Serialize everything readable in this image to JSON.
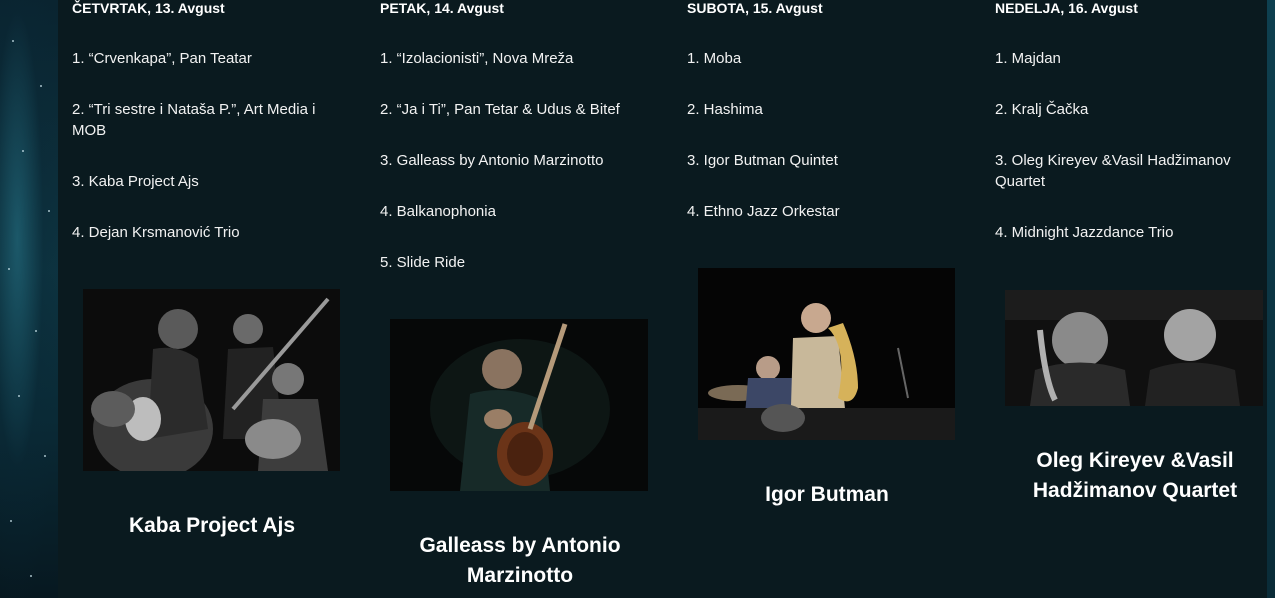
{
  "schedule": [
    {
      "day": "ČETVRTAK, 13. Avgust",
      "items": [
        "1. “Crvenkapa”, Pan Teatar",
        "2. “Tri sestre i Nataša P.”, Art Media i MOB",
        "3. Kaba Project Ajs",
        "4. Dejan Krsmanović Trio"
      ],
      "caption": "Kaba Project Ajs"
    },
    {
      "day": "PETAK, 14. Avgust",
      "items": [
        "1. “Izolacionisti”, Nova Mreža",
        "2. “Ja i Ti”, Pan Tetar & Udus & Bitef",
        "3. Galleass by Antonio Marzinotto",
        "4. Balkanophonia",
        "5. Slide Ride"
      ],
      "caption": "Galleass by Antonio Marzinotto"
    },
    {
      "day": "SUBOTA, 15. Avgust",
      "items": [
        "1. Moba",
        "2. Hashima",
        "3. Igor Butman Quintet",
        "4. Ethno Jazz Orkestar"
      ],
      "caption": "Igor Butman"
    },
    {
      "day": "NEDELJA, 16. Avgust",
      "items": [
        "1. Majdan",
        "2. Kralj Čačka",
        "3. Oleg Kireyev &Vasil Hadžimanov Quartet",
        "4. Midnight Jazzdance Trio"
      ],
      "caption": "Oleg Kireyev &Vasil Hadžimanov Quartet"
    }
  ],
  "colors": {
    "background": "#0a1a1f",
    "text": "#ffffff"
  }
}
